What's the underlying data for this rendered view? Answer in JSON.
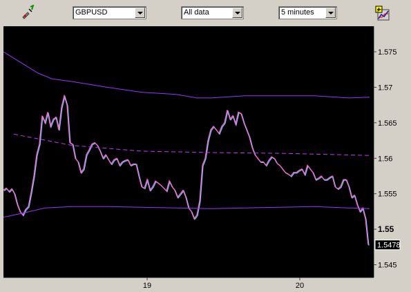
{
  "toolbar": {
    "symbol_value": "GBPUSD",
    "range_value": "All data",
    "interval_value": "5 minutes",
    "icons": [
      "draw-tool-icon",
      "chart-add-icon"
    ]
  },
  "chart_data": {
    "type": "line",
    "series": [
      {
        "color": "#ff66cc",
        "x": [
          0,
          4,
          8,
          12,
          16,
          20,
          24,
          28,
          32,
          36,
          40,
          44,
          48,
          52,
          56,
          60,
          64,
          68,
          72,
          76,
          80,
          84,
          88,
          92,
          96,
          100,
          104,
          108,
          112,
          116,
          120,
          124,
          128,
          132,
          136,
          140,
          144,
          148,
          152,
          156,
          160,
          164,
          168,
          172,
          176,
          180,
          184,
          188,
          192,
          196,
          200,
          204,
          208,
          212,
          216,
          220,
          224,
          228,
          232,
          236,
          240,
          244,
          248,
          252,
          256,
          260,
          264,
          268,
          272,
          276,
          280,
          284,
          288,
          292,
          296,
          300,
          304,
          308,
          312,
          316,
          320,
          324,
          328,
          332,
          336,
          340,
          344,
          348,
          352,
          356,
          360,
          364,
          368,
          372,
          376,
          380,
          384,
          388,
          392,
          396,
          400,
          404,
          408,
          412,
          416,
          420,
          424,
          428,
          432,
          436,
          440,
          444,
          448,
          452,
          456,
          460,
          464,
          468,
          472,
          476,
          480,
          484,
          488,
          492,
          496,
          500,
          504,
          508,
          512,
          516,
          520,
          524,
          528
        ],
        "values": [
          1.5555,
          1.5558,
          1.5553,
          1.5557,
          1.555,
          1.5535,
          1.5525,
          1.552,
          1.5528,
          1.5532,
          1.5552,
          1.5575,
          1.5605,
          1.562,
          1.566,
          1.565,
          1.5665,
          1.5645,
          1.5655,
          1.5658,
          1.564,
          1.5672,
          1.5688,
          1.5675,
          1.5622,
          1.562,
          1.56,
          1.5595,
          1.558,
          1.5585,
          1.5605,
          1.5612,
          1.562,
          1.5622,
          1.5618,
          1.561,
          1.56,
          1.5605,
          1.5598,
          1.5592,
          1.5598,
          1.56,
          1.559,
          1.5595,
          1.5597,
          1.5598,
          1.559,
          1.5592,
          1.5592,
          1.5575,
          1.556,
          1.5558,
          1.557,
          1.5555,
          1.556,
          1.5568,
          1.5565,
          1.5562,
          1.5558,
          1.5554,
          1.5568,
          1.556,
          1.5555,
          1.5545,
          1.555,
          1.5555,
          1.5545,
          1.553,
          1.5525,
          1.5515,
          1.552,
          1.554,
          1.559,
          1.56,
          1.5625,
          1.564,
          1.5645,
          1.564,
          1.5635,
          1.5645,
          1.565,
          1.5668,
          1.5655,
          1.566,
          1.5648,
          1.5665,
          1.5663,
          1.565,
          1.564,
          1.563,
          1.5615,
          1.5605,
          1.56,
          1.5595,
          1.5595,
          1.559,
          1.5597,
          1.5602,
          1.56,
          1.5593,
          1.559,
          1.5585,
          1.558,
          1.5578,
          1.5575,
          1.558,
          1.558,
          1.5583,
          1.5585,
          1.5577,
          1.559,
          1.5585,
          1.558,
          1.557,
          1.5572,
          1.5575,
          1.557,
          1.557,
          1.5573,
          1.5575,
          1.556,
          1.5557,
          1.556,
          1.557,
          1.557,
          1.556,
          1.5545,
          1.5548,
          1.5535,
          1.5525,
          1.553,
          1.5515,
          1.5478
        ]
      },
      {
        "color": "#9933ff",
        "x": [
          0,
          50,
          70,
          100,
          150,
          200,
          250,
          280,
          300,
          350,
          400,
          450,
          500,
          530
        ],
        "values": [
          1.575,
          1.572,
          1.5712,
          1.5708,
          1.57,
          1.5693,
          1.569,
          1.5685,
          1.5685,
          1.5688,
          1.5688,
          1.5688,
          1.5685,
          1.5686
        ]
      },
      {
        "color": "#9933ff",
        "x": [
          0,
          30,
          60,
          100,
          150,
          200,
          250,
          300,
          350,
          400,
          450,
          500,
          530
        ],
        "values": [
          1.5517,
          1.5523,
          1.553,
          1.5532,
          1.5532,
          1.5531,
          1.553,
          1.5529,
          1.553,
          1.5531,
          1.5532,
          1.553,
          1.5529
        ]
      },
      {
        "color": "#cc33ff",
        "dash": true,
        "x": [
          15,
          100,
          200,
          300,
          400,
          530
        ],
        "values": [
          1.5634,
          1.5618,
          1.561,
          1.5608,
          1.5607,
          1.5604
        ]
      }
    ],
    "ylim": [
      1.5432,
      1.5786
    ],
    "xlim": [
      0,
      536
    ],
    "yticks": [
      1.575,
      1.57,
      1.565,
      1.56,
      1.555,
      1.55,
      1.545
    ],
    "ytick_labels": [
      "1.575",
      "1.57",
      "1.565",
      "1.56",
      "1.555",
      "1.55",
      "1.545"
    ],
    "bold_tick": "1.55",
    "xticks": [
      208,
      429
    ],
    "xtick_labels": [
      "19",
      "20"
    ],
    "last_price": "1.5478",
    "background": "#000000",
    "grid": false
  }
}
